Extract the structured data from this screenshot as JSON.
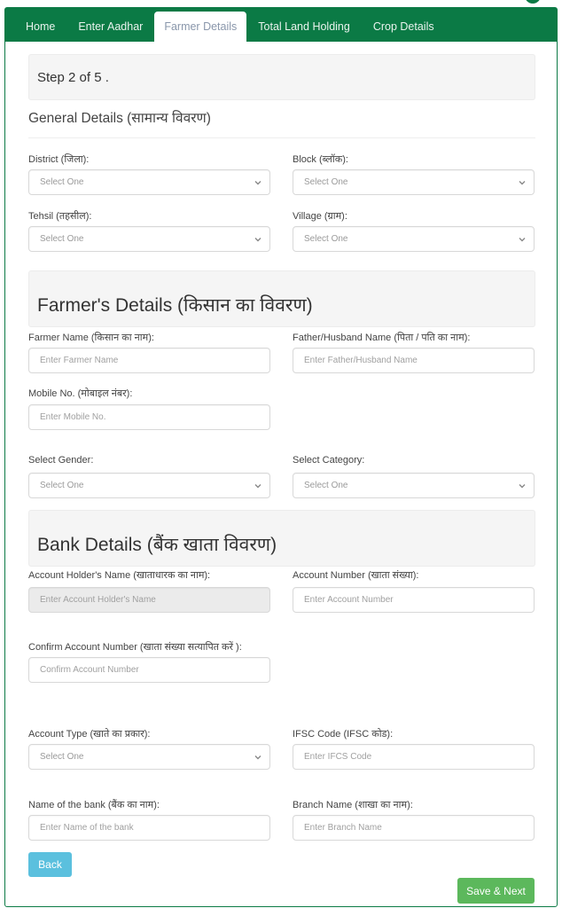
{
  "nav": {
    "tabs": [
      {
        "label": "Home",
        "active": false
      },
      {
        "label": "Enter Aadhar",
        "active": false
      },
      {
        "label": "Farmer Details",
        "active": true
      },
      {
        "label": "Total Land Holding",
        "active": false
      },
      {
        "label": "Crop Details",
        "active": false
      }
    ]
  },
  "step": {
    "text": "Step 2 of 5 ."
  },
  "general": {
    "title": "General Details (सामान्य विवरण)",
    "district": {
      "label": "District (जिला):",
      "value": "Select One"
    },
    "block": {
      "label": "Block (ब्लॉक):",
      "value": "Select One"
    },
    "tehsil": {
      "label": "Tehsil (तहसील):",
      "value": "Select One"
    },
    "village": {
      "label": "Village (ग्राम):",
      "value": "Select One"
    }
  },
  "farmer": {
    "title": "Farmer's Details (किसान का विवरण)",
    "name": {
      "label": "Farmer Name (किसान का नाम):",
      "placeholder": "Enter Farmer Name"
    },
    "father": {
      "label": "Father/Husband Name (पिता / पति का नाम):",
      "placeholder": "Enter Father/Husband Name"
    },
    "mobile": {
      "label": "Mobile No. (मोबाइल नंबर):",
      "placeholder": "Enter Mobile No."
    },
    "gender": {
      "label": "Select Gender:",
      "value": "Select One"
    },
    "category": {
      "label": "Select Category:",
      "value": "Select One"
    }
  },
  "bank": {
    "title": "Bank Details (बैंक खाता विवरण)",
    "holder": {
      "label": "Account Holder's Name (खाताधारक का नाम):",
      "placeholder": "Enter Account Holder's Name",
      "disabled": true
    },
    "account_number": {
      "label": "Account Number (खाता संख्या):",
      "placeholder": "Enter Account Number"
    },
    "confirm_account": {
      "label": "Confirm Account Number (खाता संख्या सत्यापित करें ):",
      "placeholder": "Confirm Account Number"
    },
    "account_type": {
      "label": "Account Type (खाते का प्रकार):",
      "value": "Select One"
    },
    "ifsc": {
      "label": "IFSC Code (IFSC कोड):",
      "placeholder": "Enter IFCS Code"
    },
    "bank_name": {
      "label": "Name of the bank (बैंक का नाम):",
      "placeholder": "Enter Name of the bank"
    },
    "branch": {
      "label": "Branch Name (शाखा का नाम):",
      "placeholder": "Enter Branch Name"
    }
  },
  "buttons": {
    "back": "Back",
    "save_next": "Save & Next"
  },
  "colors": {
    "nav_green": "#0b7a45",
    "back_button": "#5bc0de",
    "save_button": "#5cb85c"
  }
}
